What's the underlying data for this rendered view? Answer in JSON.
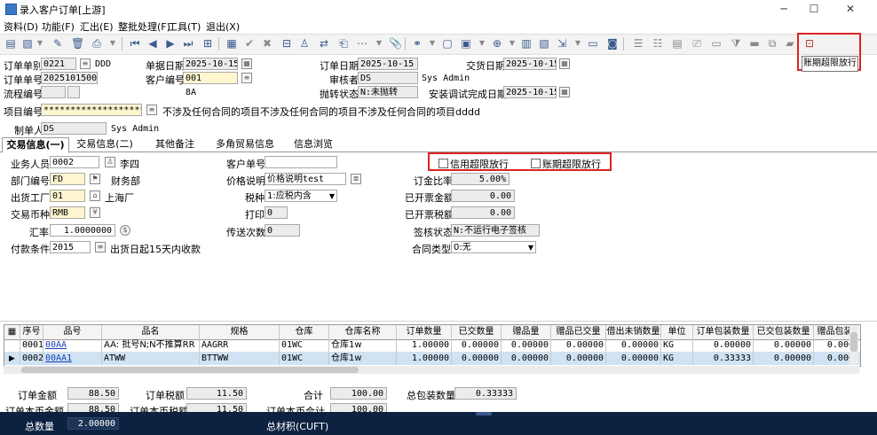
{
  "window": {
    "title": "录入客户订单[上游]"
  },
  "menu": [
    "资料(D)",
    "功能(F)",
    "汇出(E)",
    "整批处理(F)",
    "工具(T)",
    "退出(X)"
  ],
  "tooltip": "账期超限放行",
  "header": {
    "order_type_label": "订单单别",
    "order_type_value": "0221",
    "order_type_name": "DDD",
    "doc_date_label": "单据日期",
    "doc_date_value": "2025-10-15",
    "order_date_label": "订单日期",
    "order_date_value": "2025-10-15",
    "delivery_date_label": "交货日期",
    "delivery_date_value": "2025-10-15",
    "order_no_label": "订单单号",
    "order_no_value": "20251015001",
    "customer_no_label": "客户编号",
    "customer_no_value": "001",
    "reviewer_label": "审核者",
    "reviewer_value": "DS",
    "reviewer_name": "Sys Admin",
    "flow_no_label": "流程编号",
    "flow_no_extra": "8A",
    "throw_status_label": "抛转状态",
    "throw_status_value": "N:未抛转",
    "install_date_label": "安装调试完成日期",
    "install_date_value": "2025-10-15",
    "project_no_label": "项目编号",
    "project_no_value": "********************",
    "project_name": "不涉及任何合同的项目不涉及任何合同的项目不涉及任何合同的项目dddd",
    "creator_label": "制单人",
    "creator_value": "DS",
    "creator_name": "Sys Admin"
  },
  "tabs": [
    "交易信息(一)",
    "交易信息(二)",
    "其他备注",
    "多角贸易信息",
    "信息浏览"
  ],
  "form": {
    "sales_label": "业务人员",
    "sales_value": "0002",
    "sales_name": "李四",
    "customer_order_label": "客户单号",
    "customer_order_value": "",
    "credit_release_label": "信用超限放行",
    "period_release_label": "账期超限放行",
    "dept_label": "部门编号",
    "dept_value": "FD",
    "dept_name": "财务部",
    "price_desc_label": "价格说明",
    "price_desc_value": "价格说明test",
    "deposit_ratio_label": "订金比率",
    "deposit_ratio_value": "5.00%",
    "factory_label": "出货工厂",
    "factory_value": "01",
    "factory_name": "上海厂",
    "tax_label": "税种",
    "tax_value": "1:应税内含",
    "invoiced_amount_label": "已开票金额",
    "invoiced_amount_value": "0.00",
    "currency_label": "交易币种",
    "currency_value": "RMB",
    "print_label": "打印",
    "print_value": "0",
    "invoiced_tax_label": "已开票税额",
    "invoiced_tax_value": "0.00",
    "rate_label": "汇率",
    "rate_value": "1.0000000",
    "send_count_label": "传送次数",
    "send_count_value": "0",
    "sign_status_label": "签核状态",
    "sign_status_value": "N:不运行电子签核",
    "payment_label": "付款条件",
    "payment_value": "2015",
    "payment_name": "出货日起15天内收款",
    "contract_type_label": "合同类型",
    "contract_type_value": "0:无"
  },
  "grid": {
    "columns": [
      "序号",
      "品号",
      "品名",
      "规格",
      "仓库",
      "仓库名称",
      "订单数量",
      "已交数量",
      "赠品量",
      "赠品已交量",
      "借出未销数量",
      "单位",
      "订单包装数量",
      "已交包装数量",
      "赠品包装"
    ],
    "rows": [
      [
        "0001",
        "00AA",
        "AA: 批号N;N不推算RR",
        "AAGRR",
        "01WC",
        "仓库1w",
        "1.00000",
        "0.00000",
        "0.00000",
        "0.00000",
        "0.00000",
        "KG",
        "0.00000",
        "0.00000",
        "0.000"
      ],
      [
        "0002",
        "00AA1",
        "ATWW",
        "BTTWW",
        "01WC",
        "仓库1w",
        "1.00000",
        "0.00000",
        "0.00000",
        "0.00000",
        "0.00000",
        "KG",
        "0.33333",
        "0.00000",
        "0.000"
      ]
    ]
  },
  "totals": {
    "order_amount_label": "订单金额",
    "order_amount_value": "88.50",
    "order_tax_label": "订单税额",
    "order_tax_value": "11.50",
    "total_label": "合计",
    "total_value": "100.00",
    "total_pack_label": "总包装数量",
    "total_pack_value": "0.33333",
    "base_amount_label": "订单本币金额",
    "base_amount_value": "88.50",
    "base_tax_label": "订单本币税额",
    "base_tax_value": "11.50",
    "base_total_label": "订单本币合计",
    "base_total_value": "100.00",
    "total_qty_label": "总数量",
    "total_qty_value": "2.00000",
    "total_volume_label": "总材积(CUFT)"
  },
  "colors": {
    "highlight": "#d22222",
    "selected_row": "#cfe3f5",
    "status_bar": "#0d2240"
  }
}
